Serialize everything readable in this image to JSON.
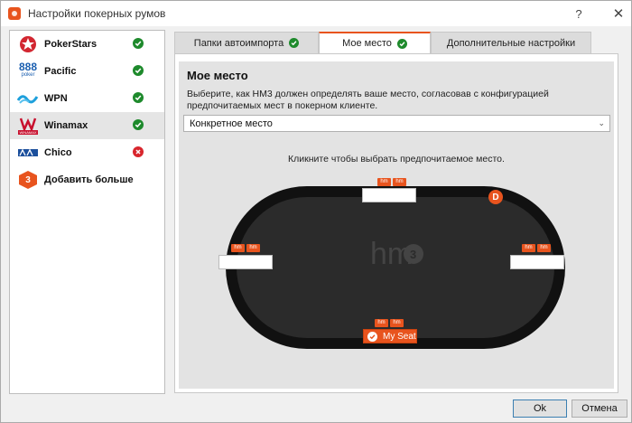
{
  "window": {
    "title": "Настройки покерных румов",
    "help": "?",
    "close": "✕"
  },
  "sidebar": {
    "items": [
      {
        "label": "PokerStars",
        "status": "ok"
      },
      {
        "label": "Pacific",
        "status": "ok"
      },
      {
        "label": "WPN",
        "status": "ok"
      },
      {
        "label": "Winamax",
        "status": "ok",
        "selected": true
      },
      {
        "label": "Chico",
        "status": "error"
      },
      {
        "label": "Добавить больше румов",
        "status": "none"
      }
    ],
    "logos": {
      "pacific_text": "888",
      "pacific_sub": "poker",
      "winamax_text": "WINAMAX",
      "add_text": "3"
    }
  },
  "tabs": [
    {
      "label": "Папки автоимпорта",
      "status": "ok"
    },
    {
      "label": "Мое место",
      "status": "ok",
      "active": true
    },
    {
      "label": "Дополнительные настройки"
    }
  ],
  "section": {
    "title": "Мое место",
    "description": "Выберите, как HM3 должен определять ваше место, согласовав с конфигурацией предпочитаемых мест в покерном клиенте.",
    "select_value": "Конкретное место",
    "hint": "Кликните чтобы выбрать предпочитаемое место."
  },
  "table": {
    "logo_text": "hm",
    "logo_badge": "3",
    "hm_label": "hm",
    "dealer_label": "D",
    "my_seat_label": "My Seat"
  },
  "buttons": {
    "ok": "Ok",
    "cancel": "Отмена"
  },
  "colors": {
    "accent": "#e8541e",
    "ok_green": "#1e8a2c",
    "error_red": "#d8262d",
    "felt": "#2a2a2a",
    "rail": "#111111"
  }
}
